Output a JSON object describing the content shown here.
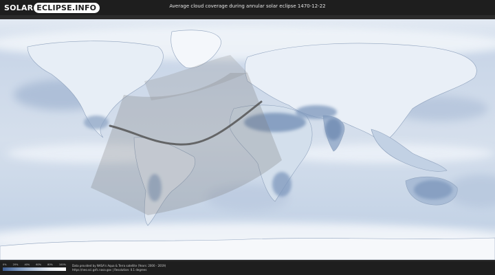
{
  "header": {
    "logo_part1": "SOLAR",
    "logo_part2": "ECLIPSE.INFO",
    "title": "Average cloud coverage during annular solar eclipse 1470-12-22"
  },
  "legend": {
    "ticks": [
      "0%",
      "20%",
      "40%",
      "60%",
      "80%",
      "100%"
    ],
    "colors": [
      "#3f5f95",
      "#7d98bf",
      "#b6c6dc",
      "#e9eef5",
      "#ffffff"
    ]
  },
  "footer": {
    "credit_line1": "Data provided by NASA's Aqua & Terra satellite (Years: 2000 - 2019)",
    "credit_line2": "https://neo.sci.gsfc.nasa.gov | Resolution: 0.1 degrees"
  },
  "map": {
    "ocean_color": "#c9d6e8",
    "land_cloud_color": "#eef3f9",
    "clear_sky_color": "#5e7eaa",
    "path_color": "#555555"
  }
}
